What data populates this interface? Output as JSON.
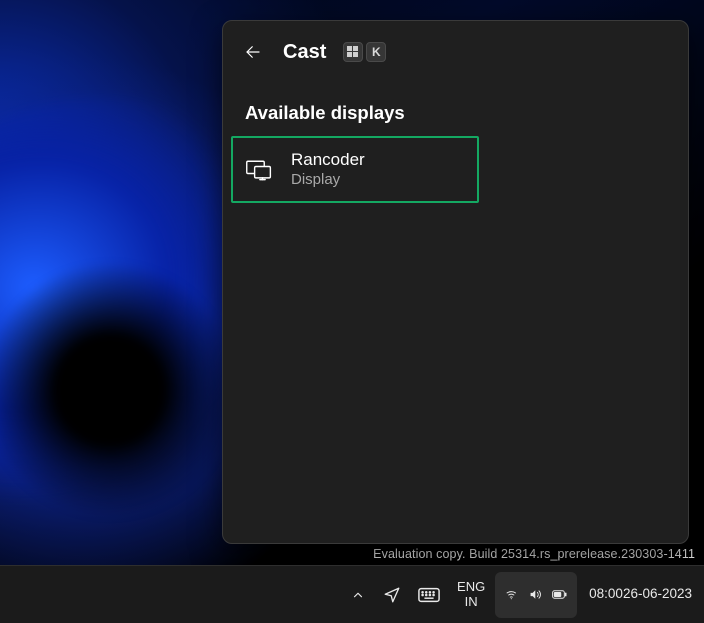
{
  "cast": {
    "title": "Cast",
    "shortcut_key_letter": "K",
    "section_heading": "Available displays",
    "devices": [
      {
        "name": "Rancoder",
        "type": "Display"
      }
    ]
  },
  "desktop": {
    "watermark": "Evaluation copy. Build 25314.rs_prerelease.230303-1411"
  },
  "taskbar": {
    "language_top": "ENG",
    "language_bottom": "IN",
    "time": "08:00",
    "date": "26-06-2023"
  }
}
